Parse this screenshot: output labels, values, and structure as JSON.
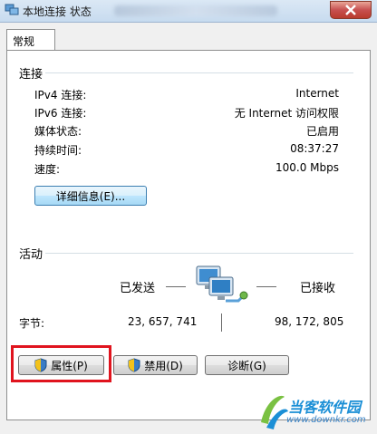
{
  "window": {
    "title": "本地连接 状态"
  },
  "tabs": [
    {
      "label": "常规"
    }
  ],
  "connection": {
    "section_label": "连接",
    "rows": [
      {
        "label": "IPv4 连接:",
        "value": "Internet"
      },
      {
        "label": "IPv6 连接:",
        "value": "无 Internet 访问权限"
      },
      {
        "label": "媒体状态:",
        "value": "已启用"
      },
      {
        "label": "持续时间:",
        "value": "08:37:27"
      },
      {
        "label": "速度:",
        "value": "100.0 Mbps"
      }
    ],
    "details_button": "详细信息(E)..."
  },
  "activity": {
    "section_label": "活动",
    "sent_label": "已发送",
    "received_label": "已接收",
    "bytes_label": "字节:",
    "bytes_sent": "23, 657, 741",
    "bytes_received": "98, 172, 805"
  },
  "buttons": {
    "properties": "属性(P)",
    "disable": "禁用(D)",
    "diagnose": "诊断(G)"
  },
  "watermark": {
    "brand": "当客软件园",
    "url": "www.downkr.com"
  },
  "colors": {
    "highlight_box": "#e0141e",
    "accent": "#1b8fd6"
  }
}
